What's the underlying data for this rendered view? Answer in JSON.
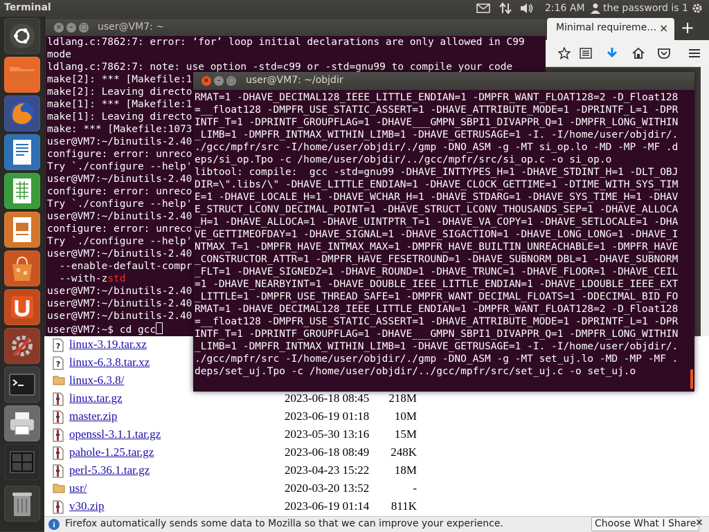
{
  "top_panel": {
    "title": "Terminal",
    "clock": "2:16 AM",
    "user": "the password is 1"
  },
  "launcher": {
    "items": [
      "dash-home",
      "files",
      "firefox",
      "writer",
      "calc",
      "impress",
      "software-center",
      "ubuntu-one",
      "system-settings",
      "terminal",
      "printer",
      "workspaces",
      "trash"
    ]
  },
  "firefox": {
    "tab_title": "Minimal requireme…",
    "tab_close": "×",
    "new_tab": "+",
    "listing": [
      {
        "name": "linux-3.19.tar.xz",
        "date": "",
        "size": "",
        "type": "unknown"
      },
      {
        "name": "linux-6.3.8.tar.xz",
        "date": "",
        "size": "",
        "type": "unknown"
      },
      {
        "name": "linux-6.3.8/",
        "date": "",
        "size": "",
        "type": "folder"
      },
      {
        "name": "linux.tar.gz",
        "date": "2023-06-18 08:45",
        "size": "218M",
        "type": "archive"
      },
      {
        "name": "master.zip",
        "date": "2023-06-19 01:18",
        "size": "10M",
        "type": "archive"
      },
      {
        "name": "openssl-3.1.1.tar.gz",
        "date": "2023-05-30 13:16",
        "size": "15M",
        "type": "archive"
      },
      {
        "name": "pahole-1.25.tar.gz",
        "date": "2023-06-18 08:49",
        "size": "248K",
        "type": "archive"
      },
      {
        "name": "perl-5.36.1.tar.gz",
        "date": "2023-04-23 15:22",
        "size": "18M",
        "type": "archive"
      },
      {
        "name": "usr/",
        "date": "2020-03-20 13:52",
        "size": "-",
        "type": "folder"
      },
      {
        "name": "v30.zip",
        "date": "2023-06-19 01:14",
        "size": "811K",
        "type": "archive"
      }
    ],
    "notification": "Firefox automatically sends some data to Mozilla so that we can improve your experience.",
    "notification_button": "Choose What I Share"
  },
  "term1": {
    "title": "user@VM7: ~",
    "lines": [
      "ldlang.c:7862:7: error: ‘for’ loop initial declarations are only allowed in C99",
      "mode",
      "ldlang.c:7862:7: note: use option -std=c99 or -std=gnu99 to compile your code",
      "make[2]: *** [Makefile:1",
      "make[2]: Leaving directo",
      "make[1]: *** [Makefile:1",
      "make[1]: Leaving directo",
      "make: *** [Makefile:1073",
      "user@VM7:~/binutils-2.40",
      "configure: error: unreco",
      "Try `./configure --help'",
      "user@VM7:~/binutils-2.40",
      "configure: error: unreco",
      "Try `./configure --help'",
      "user@VM7:~/binutils-2.40",
      "configure: error: unreco",
      "Try `./configure --help'",
      "user@VM7:~/binutils-2.40",
      "  --enable-default-compr",
      "  --with-z",
      "user@VM7:~/binutils-2.40",
      "user@VM7:~/binutils-2.40",
      "user@VM7:~/binutils-2.40",
      "user@VM7:~$ cd gcc"
    ],
    "highlight": "std"
  },
  "term2": {
    "title": "user@VM7: ~/objdir",
    "lines": [
      "RMAT=1 -DHAVE_DECIMAL128_IEEE_LITTLE_ENDIAN=1 -DMPFR_WANT_FLOAT128=2 -D_Float128",
      "=__float128 -DMPFR_USE_STATIC_ASSERT=1 -DHAVE_ATTRIBUTE_MODE=1 -DPRINTF_L=1 -DPR",
      "INTF_T=1 -DPRINTF_GROUPFLAG=1 -DHAVE___GMPN_SBPI1_DIVAPPR_Q=1 -DMPFR_LONG_WITHIN",
      "_LIMB=1 -DMPFR_INTMAX_WITHIN_LIMB=1 -DHAVE_GETRUSAGE=1 -I. -I/home/user/objdir/.",
      "./gcc/mpfr/src -I/home/user/objdir/./gmp -DNO_ASM -g -MT si_op.lo -MD -MP -MF .d",
      "eps/si_op.Tpo -c /home/user/objdir/../gcc/mpfr/src/si_op.c -o si_op.o",
      "libtool: compile:  gcc -std=gnu99 -DHAVE_INTTYPES_H=1 -DHAVE_STDINT_H=1 -DLT_OBJ",
      "DIR=\\\".libs/\\\" -DHAVE_LITTLE_ENDIAN=1 -DHAVE_CLOCK_GETTIME=1 -DTIME_WITH_SYS_TIM",
      "E=1 -DHAVE_LOCALE_H=1 -DHAVE_WCHAR_H=1 -DHAVE_STDARG=1 -DHAVE_SYS_TIME_H=1 -DHAV",
      "E_STRUCT_LCONV_DECIMAL_POINT=1 -DHAVE_STRUCT_LCONV_THOUSANDS_SEP=1 -DHAVE_ALLOCA",
      "_H=1 -DHAVE_ALLOCA=1 -DHAVE_UINTPTR_T=1 -DHAVE_VA_COPY=1 -DHAVE_SETLOCALE=1 -DHA",
      "VE_GETTIMEOFDAY=1 -DHAVE_SIGNAL=1 -DHAVE_SIGACTION=1 -DHAVE_LONG_LONG=1 -DHAVE_I",
      "NTMAX_T=1 -DMPFR_HAVE_INTMAX_MAX=1 -DMPFR_HAVE_BUILTIN_UNREACHABLE=1 -DMPFR_HAVE",
      "_CONSTRUCTOR_ATTR=1 -DMPFR_HAVE_FESETROUND=1 -DHAVE_SUBNORM_DBL=1 -DHAVE_SUBNORM",
      "_FLT=1 -DHAVE_SIGNEDZ=1 -DHAVE_ROUND=1 -DHAVE_TRUNC=1 -DHAVE_FLOOR=1 -DHAVE_CEIL",
      "=1 -DHAVE_NEARBYINT=1 -DHAVE_DOUBLE_IEEE_LITTLE_ENDIAN=1 -DHAVE_LDOUBLE_IEEE_EXT",
      "_LITTLE=1 -DMPFR_USE_THREAD_SAFE=1 -DMPFR_WANT_DECIMAL_FLOATS=1 -DDECIMAL_BID_FO",
      "RMAT=1 -DHAVE_DECIMAL128_IEEE_LITTLE_ENDIAN=1 -DMPFR_WANT_FLOAT128=2 -D_Float128",
      "=__float128 -DMPFR_USE_STATIC_ASSERT=1 -DHAVE_ATTRIBUTE_MODE=1 -DPRINTF_L=1 -DPR",
      "INTF_T=1 -DPRINTF_GROUPFLAG=1 -DHAVE___GMPN_SBPI1_DIVAPPR_Q=1 -DMPFR_LONG_WITHIN",
      "_LIMB=1 -DMPFR_INTMAX_WITHIN_LIMB=1 -DHAVE_GETRUSAGE=1 -I. -I/home/user/objdir/.",
      "./gcc/mpfr/src -I/home/user/objdir/./gmp -DNO_ASM -g -MT set_uj.lo -MD -MP -MF .",
      "deps/set_uj.Tpo -c /home/user/objdir/../gcc/mpfr/src/set_uj.c -o set_uj.o"
    ]
  },
  "colors": {
    "terminal_bg": "#300a24",
    "ubuntu_orange": "#e95420",
    "link": "#1a0dab",
    "highlight_red": "#ef2929"
  }
}
